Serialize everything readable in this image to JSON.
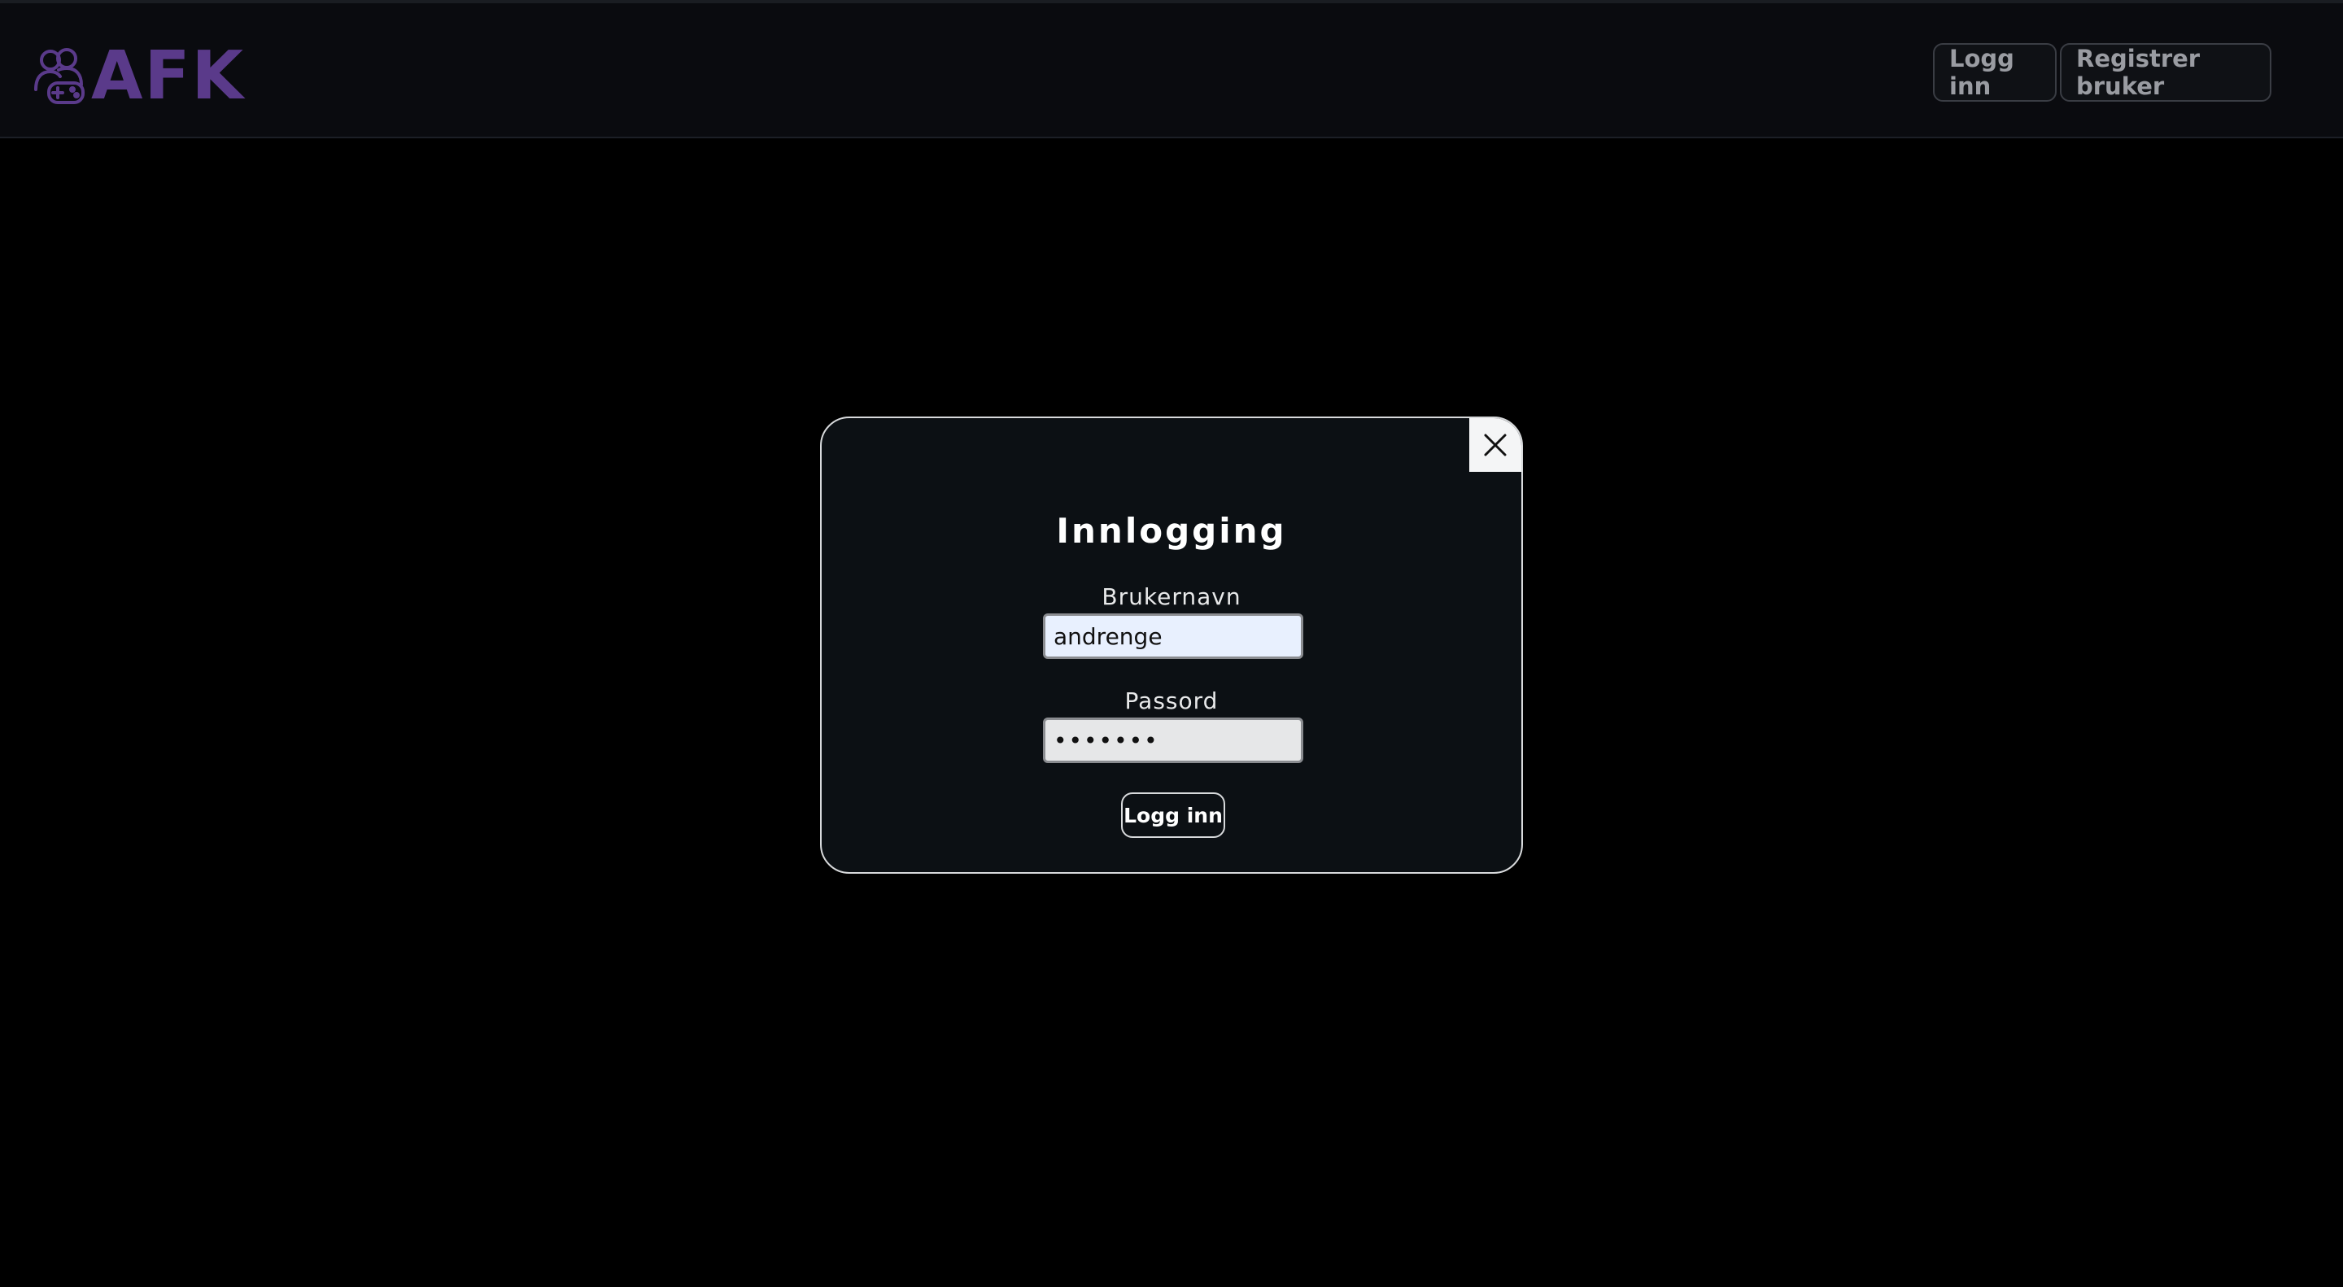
{
  "app": {
    "logo_text": "AFK",
    "logo_icon": "gamers-controller-icon",
    "brand_color": "#5a3a8a"
  },
  "navbar": {
    "login_label": "Logg inn",
    "register_label": "Registrer bruker"
  },
  "login_modal": {
    "title": "Innlogging",
    "close_icon": "close-icon",
    "username": {
      "label": "Brukernavn",
      "value": "andrenge"
    },
    "password": {
      "label": "Passord",
      "value": "•••••••"
    },
    "submit_label": "Logg inn"
  }
}
